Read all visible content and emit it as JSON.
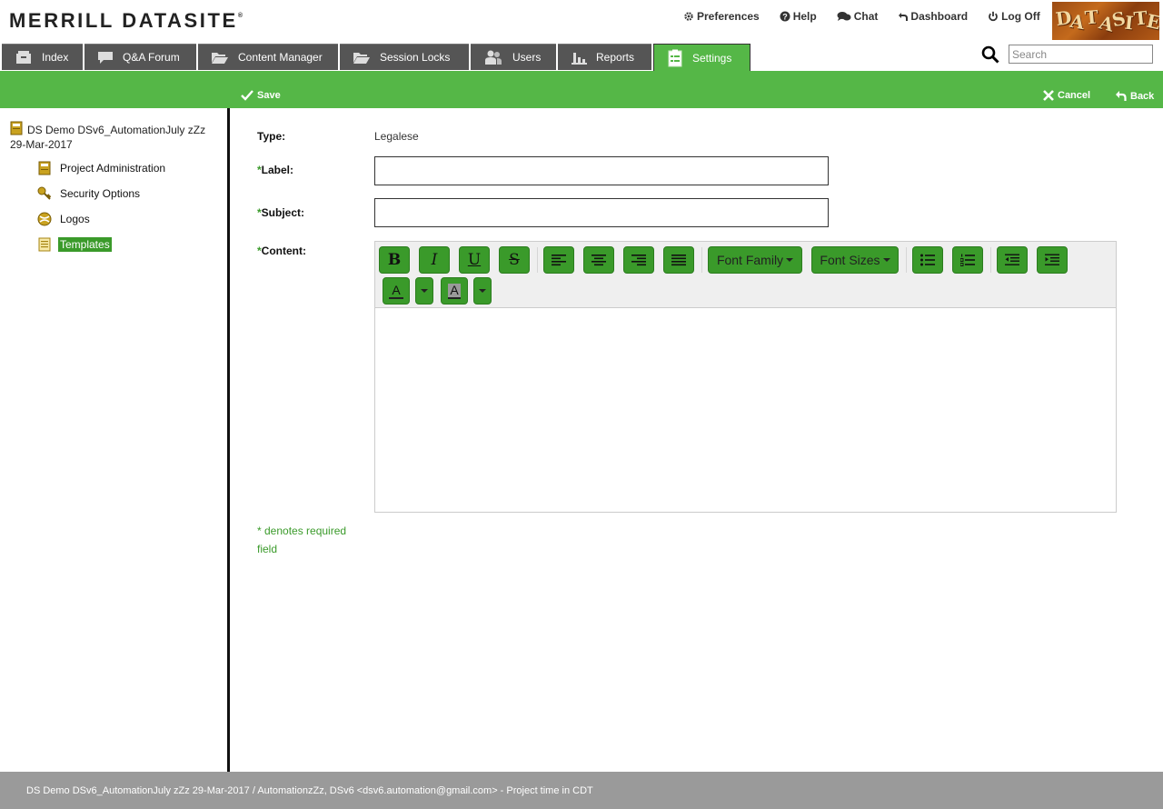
{
  "header": {
    "brand": "MERRILL DATASITE",
    "brand_mark": "®",
    "links": [
      "Preferences",
      "Help",
      "Chat",
      "Dashboard",
      "Log Off"
    ],
    "logo_text": "DATASITE"
  },
  "tabs": [
    "Index",
    "Q&A Forum",
    "Content Manager",
    "Session Locks",
    "Users",
    "Reports",
    "Settings"
  ],
  "active_tab": "Settings",
  "search": {
    "placeholder": "Search",
    "value": ""
  },
  "actionbar": {
    "save": "Save",
    "cancel": "Cancel",
    "back": "Back"
  },
  "sidebar": {
    "project": "DS Demo DSv6_AutomationJuly zZz 29-Mar-2017",
    "items": [
      "Project Administration",
      "Security Options",
      "Logos",
      "Templates"
    ],
    "selected": "Templates"
  },
  "form": {
    "type_label": "Type:",
    "type_value": "Legalese",
    "required_mark": "*",
    "label_label": "Label:",
    "label_value": "",
    "subject_label": "Subject:",
    "subject_value": "",
    "content_label": "Content:"
  },
  "editor": {
    "buttons": {
      "bold": "B",
      "italic": "I",
      "underline": "U",
      "strike": "S",
      "font_family": "Font Family",
      "font_sizes": "Font Sizes",
      "font_color": "A",
      "highlight": "A"
    }
  },
  "note": "* denotes required field",
  "footer": {
    "text": "DS Demo DSv6_AutomationJuly zZz 29-Mar-2017  /  AutomationzZz, DSv6 <dsv6.automation@gmail.com> - Project time in CDT"
  },
  "colors": {
    "green": "#55b747",
    "dark_green": "#3a9a2a",
    "tab_gray": "#555555",
    "footer_gray": "#9a9a9a"
  }
}
